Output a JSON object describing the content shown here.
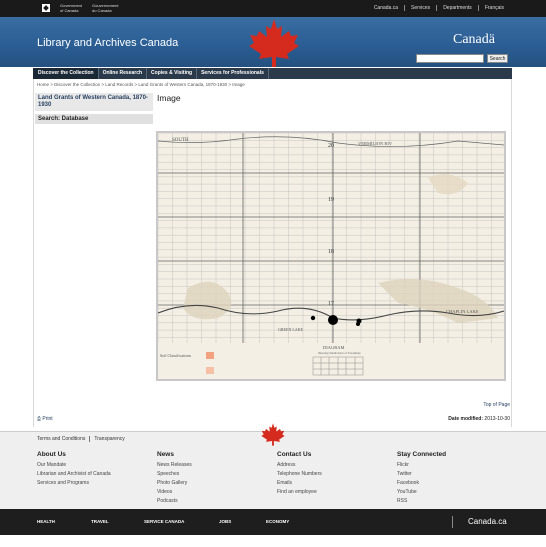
{
  "fip": {
    "gov_en": [
      "Government",
      "of Canada"
    ],
    "gov_fr": [
      "Gouvernement",
      "du Canada"
    ],
    "links": [
      "Canada.ca",
      "Services",
      "Departments",
      "Français"
    ]
  },
  "banner": {
    "site_title": "Library and Archives Canada",
    "wordmark": "Canadä",
    "search_button": "Search"
  },
  "menu": [
    "Discover the Collection",
    "Online Research",
    "Copies & Visiting",
    "Services for Professionals"
  ],
  "breadcrumb": "Home > Discover the Collection > Land Records > Land Grants of Western Canada, 1870-1930 > Image",
  "sidebar": {
    "section_title": "Land Grants of Western Canada, 1870-1930",
    "subsection": "Search: Database"
  },
  "main": {
    "heading": "Image",
    "map": {
      "top_label": "SOUTH",
      "vermilion_label": "VERMILION RIV",
      "township_labels": [
        "20",
        "19",
        "18",
        "17"
      ],
      "river_label": "CHAPLIN LAKE",
      "creek_label": "GREEN LAKE",
      "diagram_title": "DIAGRAM",
      "diagram_subtitle": "Shewing Subdivision of Townships",
      "legend_label": "Soil Classifications"
    }
  },
  "top_of_page": "Top of Page",
  "print": "Print",
  "date_modified_label": "Date modified:",
  "date_modified": "2013-10-30",
  "footer": {
    "links": [
      "Terms and Conditions",
      "Transparency"
    ],
    "about": {
      "title": "About Us",
      "items": [
        "Our Mandate",
        "Librarian and Archivist of Canada",
        "Services and Programs"
      ]
    },
    "news": {
      "title": "News",
      "items": [
        "News Releases",
        "Speeches",
        "Photo Gallery",
        "Videos",
        "Podcasts"
      ]
    },
    "contact": {
      "title": "Contact Us",
      "items": [
        "Address",
        "Telephone Numbers",
        "Emails",
        "Find an employee"
      ]
    },
    "connected": {
      "title": "Stay Connected",
      "items": [
        "Flickr",
        "Twitter",
        "Facebook",
        "YouTube",
        "RSS"
      ]
    }
  },
  "bottom": {
    "links": [
      "HEALTH",
      "TRAVEL",
      "SERVICE CANADA",
      "JOBS",
      "ECONOMY"
    ],
    "canada_ca": "Canada.ca"
  },
  "colors": {
    "banner_blue": "#2a5d93",
    "menu_dark": "#2b3a4a",
    "flag_red": "#d52b1e"
  }
}
